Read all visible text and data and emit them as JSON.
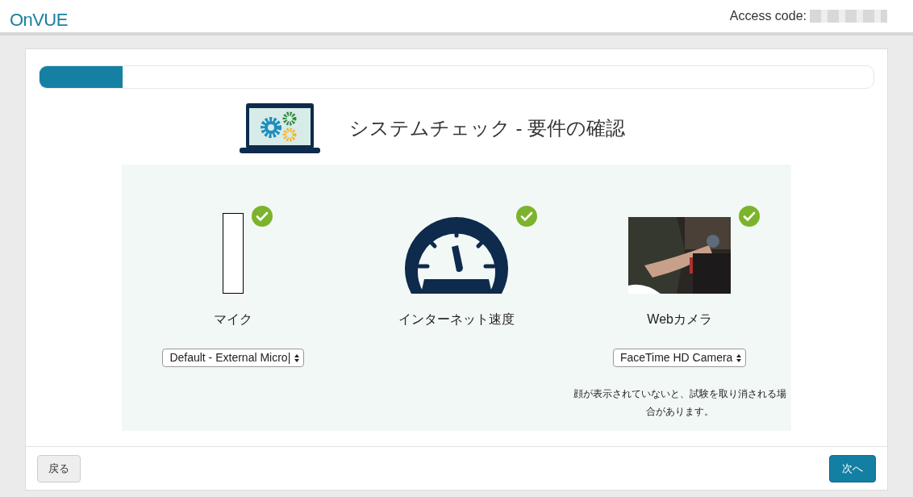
{
  "header": {
    "logo": "OnVUE",
    "access_label": "Access code:"
  },
  "progress": {
    "level": 0.1
  },
  "title": "システムチェック - 要件の確認",
  "checks": [
    {
      "kind": "microphone",
      "label": "マイク",
      "checked": true,
      "level": 0,
      "select": "Default - External Micro|"
    },
    {
      "kind": "speed",
      "label": "インターネット速度",
      "checked": true
    },
    {
      "kind": "camera",
      "label": "Webカメラ",
      "checked": true,
      "select": "FaceTime HD Camera",
      "note": "顔が表示されていないと、試験を取り消される場合があります。"
    }
  ],
  "footer": {
    "back": "戻る",
    "next": "次へ"
  }
}
